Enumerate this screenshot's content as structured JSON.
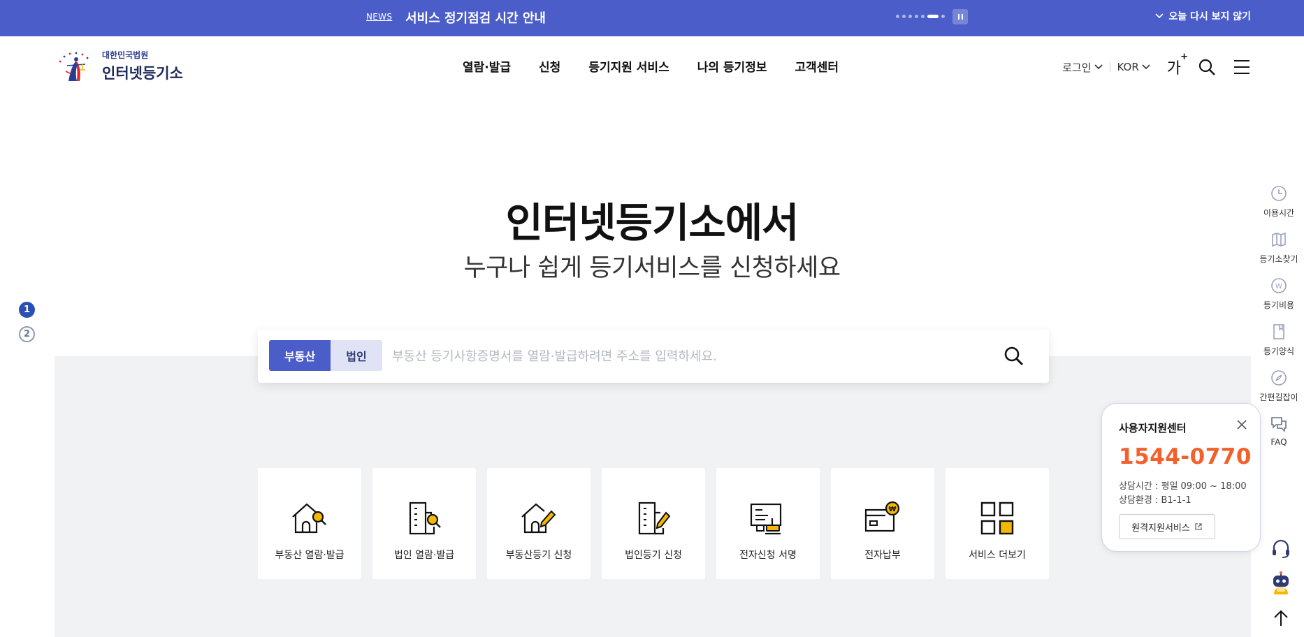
{
  "notice": {
    "tag": "NEWS",
    "title": "서비스 정기점검 시간 안내",
    "dismiss_label": "오늘 다시 보지 않기",
    "slide_count": 7,
    "active_slide": 6
  },
  "logo": {
    "subtitle": "대한민국법원",
    "title": "인터넷등기소"
  },
  "nav": {
    "items": [
      "열람·발급",
      "신청",
      "등기지원 서비스",
      "나의 등기정보",
      "고객센터"
    ]
  },
  "util": {
    "login_label": "로그인",
    "lang_label": "KOR",
    "font_label": "가",
    "font_plus": "+"
  },
  "hero": {
    "title": "인터넷등기소에서",
    "subtitle": "누구나 쉽게 등기서비스를 신청하세요"
  },
  "pager": {
    "items": [
      "1",
      "2"
    ],
    "current": "1"
  },
  "search": {
    "tabs": [
      "부동산",
      "법인"
    ],
    "active_tab": "부동산",
    "placeholder": "부동산 등기사항증명서를 열람·발급하려면 주소를 입력하세요.",
    "value": ""
  },
  "services": [
    {
      "label": "부동산 열람·발급",
      "icon": "house-search-icon"
    },
    {
      "label": "법인 열람·발급",
      "icon": "building-search-icon"
    },
    {
      "label": "부동산등기 신청",
      "icon": "house-edit-icon"
    },
    {
      "label": "법인등기 신청",
      "icon": "building-edit-icon"
    },
    {
      "label": "전자신청 서명",
      "icon": "e-sign-icon"
    },
    {
      "label": "전자납부",
      "icon": "e-payment-icon"
    },
    {
      "label": "서비스 더보기",
      "icon": "grid-more-icon"
    }
  ],
  "quick_menu": [
    {
      "label": "이용시간",
      "icon": "clock-icon"
    },
    {
      "label": "등기소찾기",
      "icon": "map-icon"
    },
    {
      "label": "등기비용",
      "icon": "won-coin-icon"
    },
    {
      "label": "등기양식",
      "icon": "form-icon"
    },
    {
      "label": "간편길잡이",
      "icon": "compass-icon"
    },
    {
      "label": "FAQ",
      "icon": "chat-icon"
    }
  ],
  "support": {
    "title": "사용자지원센터",
    "phone": "1544-0770",
    "hours": "상담시간 : 평일 09:00 ~ 18:00",
    "env": "상담환경 : B1-1-1",
    "remote_label": "원격지원서비스"
  },
  "colors": {
    "brand": "#4b5dc9",
    "accent": "#f2602b",
    "icon_yellow": "#f5b800",
    "panel": "#f1f2f4"
  }
}
